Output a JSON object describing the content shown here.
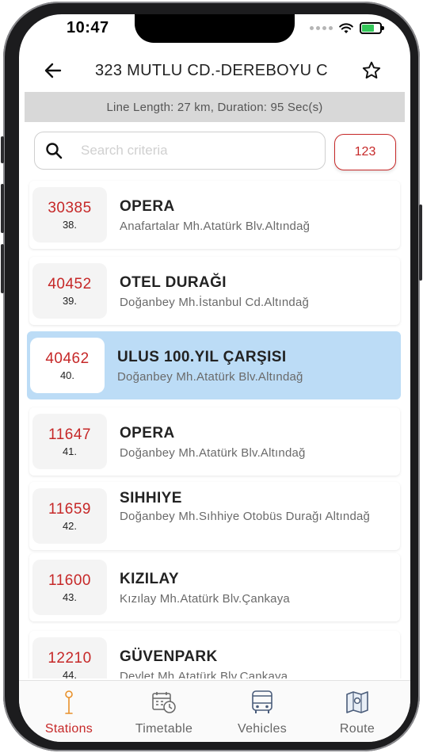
{
  "status_bar": {
    "time": "10:47"
  },
  "header": {
    "title": "323 MUTLU CD.-DEREBOYU C"
  },
  "info": "Line Length: 27 km, Duration: 95 Sec(s)",
  "search": {
    "placeholder": "Search criteria",
    "count_label": "123"
  },
  "stops": [
    {
      "code": "30385",
      "order": "38.",
      "name": "OPERA",
      "address": "Anafartalar Mh.Atatürk Blv.Altındağ",
      "selected": false
    },
    {
      "code": "40452",
      "order": "39.",
      "name": "OTEL DURAĞI",
      "address": "Doğanbey Mh.İstanbul Cd.Altındağ",
      "selected": false
    },
    {
      "code": "40462",
      "order": "40.",
      "name": "ULUS 100.YIL ÇARŞISI",
      "address": "Doğanbey Mh.Atatürk Blv.Altındağ",
      "selected": true
    },
    {
      "code": "11647",
      "order": "41.",
      "name": "OPERA",
      "address": "Doğanbey Mh.Atatürk Blv.Altındağ",
      "selected": false
    },
    {
      "code": "11659",
      "order": "42.",
      "name": "SIHHIYE",
      "address": "Doğanbey Mh.Sıhhiye Otobüs Durağı Altındağ",
      "selected": false
    },
    {
      "code": "11600",
      "order": "43.",
      "name": "KIZILAY",
      "address": "Kızılay Mh.Atatürk Blv.Çankaya",
      "selected": false
    },
    {
      "code": "12210",
      "order": "44.",
      "name": "GÜVENPARK",
      "address": "Devlet Mh.Atatürk Blv.Çankaya",
      "selected": false
    }
  ],
  "tabs": [
    {
      "label": "Stations",
      "icon": "bus-stop-icon",
      "active": true
    },
    {
      "label": "Timetable",
      "icon": "calendar-clock-icon",
      "active": false
    },
    {
      "label": "Vehicles",
      "icon": "bus-icon",
      "active": false
    },
    {
      "label": "Route",
      "icon": "map-icon",
      "active": false
    }
  ],
  "colors": {
    "accent": "#c62828",
    "selected_row": "#bcdcf6",
    "info_bar": "#d8d8d8"
  }
}
